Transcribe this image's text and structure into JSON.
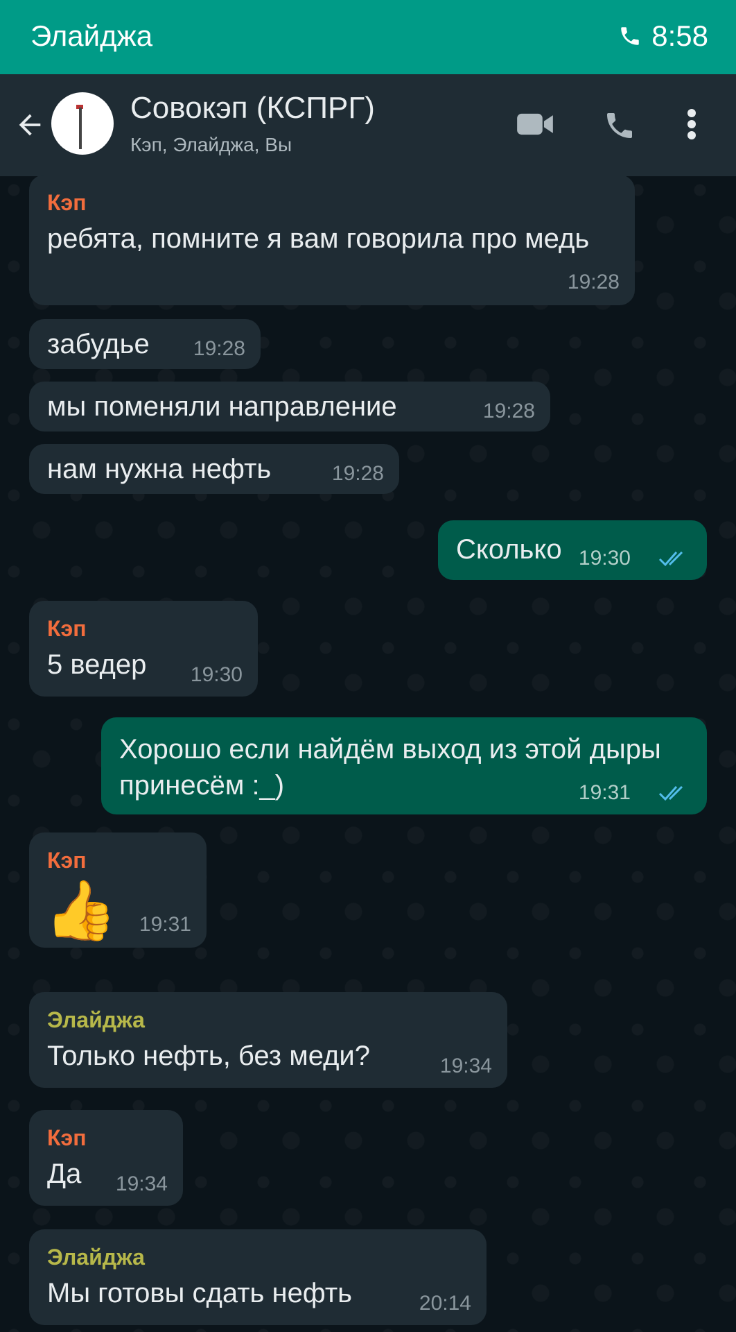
{
  "status_bar": {
    "caller": "Элайджа",
    "time": "8:58",
    "icon": "phone-icon"
  },
  "header": {
    "title": "Совокэп (КСПРГ)",
    "members": "Кэп, Элайджа, Вы",
    "icons": [
      "back-arrow-icon",
      "video-call-icon",
      "voice-call-icon",
      "more-icon"
    ]
  },
  "messages": [
    {
      "sender": "Кэп",
      "text": "ребята, помните я вам говорила про медь",
      "time": "19:28"
    },
    {
      "text": "забудье",
      "time": "19:28"
    },
    {
      "text": "мы поменяли направление",
      "time": "19:28"
    },
    {
      "text": "нам нужна нефть",
      "time": "19:28"
    },
    {
      "text": "Сколько",
      "time": "19:30",
      "outgoing": true
    },
    {
      "sender": "Кэп",
      "text": "5 ведер",
      "time": "19:30"
    },
    {
      "text": "Хорошо если найдём выход из этой дыры принесём :_)",
      "time": "19:31",
      "outgoing": true
    },
    {
      "sender": "Кэп",
      "text": "👍",
      "time": "19:31"
    },
    {
      "sender": "Элайджа",
      "text": "Только нефть, без меди?",
      "time": "19:34"
    },
    {
      "sender": "Кэп",
      "text": "Да",
      "time": "19:34"
    },
    {
      "sender": "Элайджа",
      "text": "Мы готовы сдать нефть",
      "time": "20:14"
    }
  ],
  "colors": {
    "call_bar": "#009b87",
    "header": "#1f2c34",
    "incoming_bubble": "#1f2c34",
    "outgoing_bubble": "#005c4b",
    "sender_kep": "#f26d3d",
    "sender_elijah": "#b7b84a",
    "read_ticks": "#53bdeb"
  }
}
